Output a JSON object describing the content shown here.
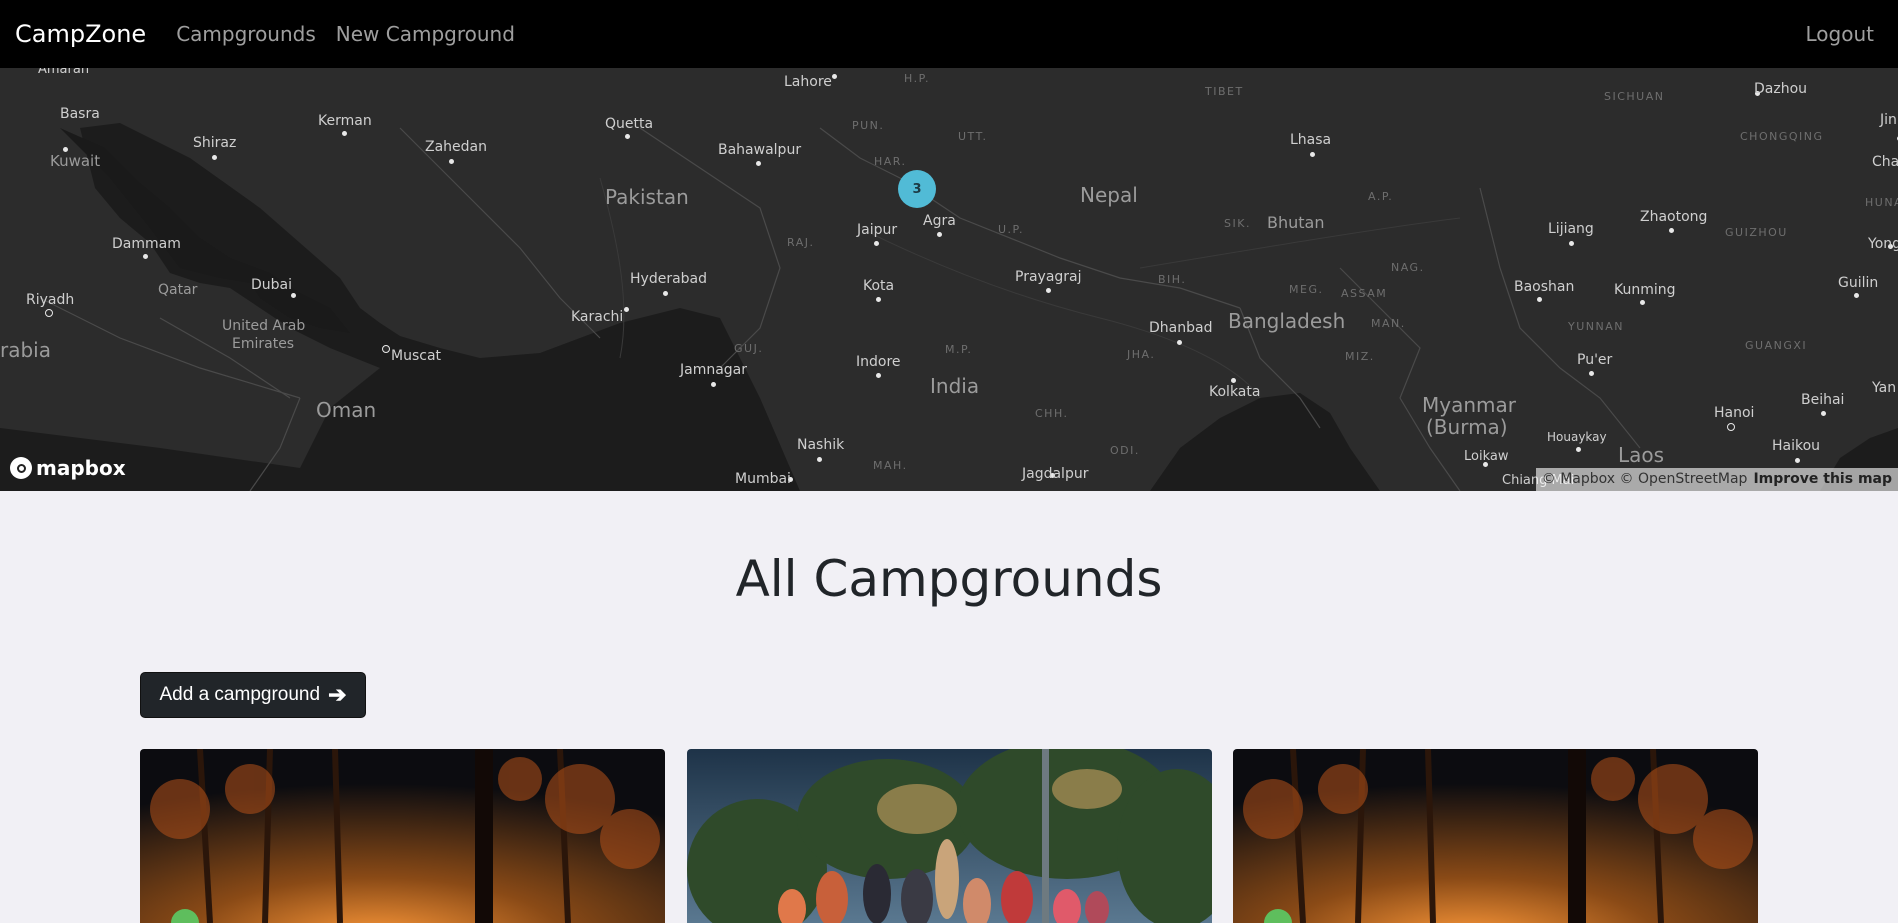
{
  "navbar": {
    "brand": "CampZone",
    "links": [
      "Campgrounds",
      "New Campground"
    ],
    "logout": "Logout"
  },
  "map": {
    "cluster_count": "3",
    "countries": [
      "Pakistan",
      "Nepal",
      "India",
      "Bangladesh",
      "Oman",
      "Bhutan",
      "Myanmar",
      "(Burma)",
      "Laos",
      "Qatar",
      "United Arab",
      "Emirates",
      "Kuwait",
      "Tibet",
      "rabia"
    ],
    "cities": [
      "Amaran",
      "Basra",
      "Kerman",
      "Shiraz",
      "Zahedan",
      "Quetta",
      "Lahore",
      "Bahawalpur",
      "Lhasa",
      "Dazhou",
      "Jaipur",
      "Agra",
      "Dammam",
      "Dubai",
      "Riyadh",
      "Hyderabad",
      "Karachi",
      "Muscat",
      "Kota",
      "Prayagraj",
      "Jamnagar",
      "Indore",
      "Dhanbad",
      "Kolkata",
      "Nashik",
      "Mumbai",
      "Jagdalpur",
      "Lijiang",
      "Zhaotong",
      "Baoshan",
      "Kunming",
      "Pu'er",
      "Guilin",
      "Hanoi",
      "Beihai",
      "Haikou",
      "Houaykay",
      "Loikaw",
      "Chiang Mai",
      "Yan",
      "Yong",
      "Char",
      "Jin"
    ],
    "regions": [
      "TIBET",
      "SICHUAN",
      "CHONGQING",
      "HUNA",
      "GUIZHOU",
      "GUANGXI",
      "YUNNAN",
      "H.P.",
      "PUN.",
      "HAR.",
      "UTT.",
      "U.P.",
      "RAJ.",
      "GUJ.",
      "M.P.",
      "CHH.",
      "ODI.",
      "MAH.",
      "JHA.",
      "BIH.",
      "SIK.",
      "A.P.",
      "ASSAM",
      "NAG.",
      "MEG.",
      "MAN.",
      "MIZ."
    ],
    "logo_text": "mapbox",
    "attribution": "© Mapbox © OpenStreetMap",
    "improve": "Improve this map"
  },
  "main": {
    "title": "All Campgrounds",
    "add_button": "Add a campground",
    "add_button_icon": "arrow-right-icon"
  },
  "cards": [
    {
      "image": "forest-campfire-night"
    },
    {
      "image": "people-around-campfire"
    },
    {
      "image": "forest-campfire-night"
    }
  ]
}
